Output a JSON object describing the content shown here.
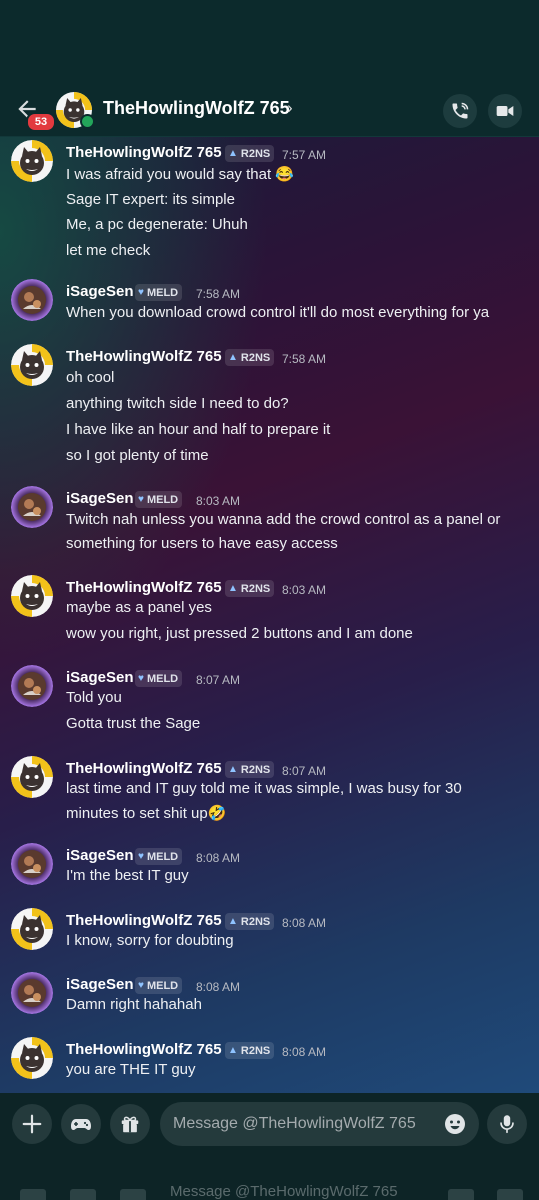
{
  "header": {
    "title": "TheHowlingWolfZ 765",
    "unread_count": "53",
    "chevron": "›",
    "icons": {
      "back": "back-arrow-icon",
      "call": "phone-call-icon",
      "video": "video-camera-icon"
    }
  },
  "messages": [
    {
      "author": "TheHowlingWolfZ 765",
      "tag": "R2NS",
      "time": "7:57 AM",
      "lines": [
        "I was afraid you would say that 😂",
        "Sage IT expert: its simple",
        "Me, a pc degenerate: Uhuh",
        "let me check"
      ]
    },
    {
      "author": "iSageSen",
      "tag": "MELD",
      "time": "7:58 AM",
      "lines": [
        "When you download crowd control it'll do most everything for ya"
      ]
    },
    {
      "author": "TheHowlingWolfZ 765",
      "tag": "R2NS",
      "time": "7:58 AM",
      "lines": [
        "oh cool",
        "anything twitch side I need to do?",
        "I have like an hour and half to prepare it",
        "so I got plenty of time"
      ]
    },
    {
      "author": "iSageSen",
      "tag": "MELD",
      "time": "8:03 AM",
      "lines": [
        "Twitch nah unless you wanna add the crowd control as a panel or",
        "something for users to have easy access"
      ]
    },
    {
      "author": "TheHowlingWolfZ 765",
      "tag": "R2NS",
      "time": "8:03 AM",
      "lines": [
        "maybe as a panel yes",
        "wow you right, just pressed 2 buttons and I am done"
      ]
    },
    {
      "author": "iSageSen",
      "tag": "MELD",
      "time": "8:07 AM",
      "lines": [
        "Told you",
        "Gotta trust the Sage"
      ]
    },
    {
      "author": "TheHowlingWolfZ 765",
      "tag": "R2NS",
      "time": "8:07 AM",
      "lines": [
        "last time and IT guy told me it was simple, I was busy for 30",
        "minutes to set shit up🤣"
      ]
    },
    {
      "author": "iSageSen",
      "tag": "MELD",
      "time": "8:08 AM",
      "lines": [
        "I'm the best IT guy"
      ]
    },
    {
      "author": "TheHowlingWolfZ 765",
      "tag": "R2NS",
      "time": "8:08 AM",
      "lines": [
        "I know, sorry for doubting"
      ]
    },
    {
      "author": "iSageSen",
      "tag": "MELD",
      "time": "8:08 AM",
      "lines": [
        "Damn right hahahah"
      ]
    },
    {
      "author": "TheHowlingWolfZ 765",
      "tag": "R2NS",
      "time": "8:08 AM",
      "lines": [
        "you are THE IT guy"
      ]
    }
  ],
  "composer": {
    "placeholder": "Message @TheHowlingWolfZ 765",
    "ghost_text": "Message @TheHowlingWolfZ 765",
    "icons": {
      "add": "plus-icon",
      "games": "gamepad-icon",
      "gift": "gift-icon",
      "emoji": "emoji-icon",
      "mic": "microphone-icon"
    }
  }
}
